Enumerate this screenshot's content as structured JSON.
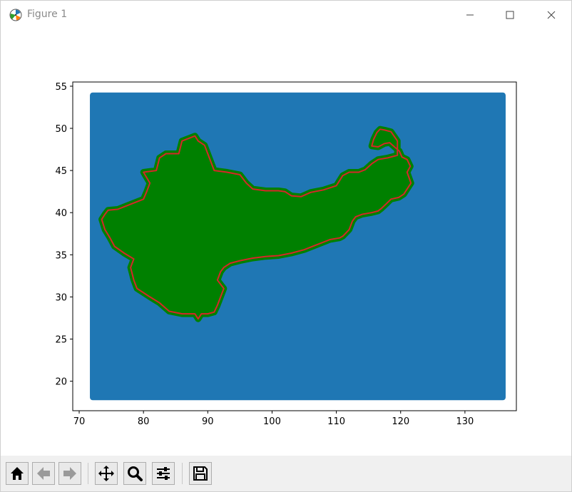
{
  "window": {
    "title": "Figure 1",
    "controls": [
      "minimize",
      "maximize",
      "close"
    ]
  },
  "toolbar": {
    "buttons": [
      {
        "name": "home-button",
        "icon": "home-icon"
      },
      {
        "name": "back-button",
        "icon": "arrow-left-icon"
      },
      {
        "name": "forward-button",
        "icon": "arrow-right-icon"
      },
      {
        "name": "pan-button",
        "icon": "move-icon"
      },
      {
        "name": "zoom-button",
        "icon": "magnifier-icon"
      },
      {
        "name": "configure-subplots-button",
        "icon": "sliders-icon"
      },
      {
        "name": "save-button",
        "icon": "floppy-disk-icon"
      }
    ]
  },
  "colors": {
    "background_points": "#1f77b4",
    "region_fill": "#008000",
    "outline": "#d62728"
  },
  "chart_data": {
    "type": "scatter",
    "title": "",
    "xlabel": "",
    "ylabel": "",
    "xlim": [
      69,
      138
    ],
    "ylim": [
      16.5,
      55.5
    ],
    "xticks": [
      70,
      80,
      90,
      100,
      110,
      120,
      130
    ],
    "yticks": [
      20,
      25,
      30,
      35,
      40,
      45,
      50,
      55
    ],
    "grid": false,
    "series": [
      {
        "kind": "grid-points",
        "color": "#1f77b4",
        "x_range": [
          72,
          136
        ],
        "y_range": [
          18,
          54
        ]
      },
      {
        "kind": "filled-region",
        "color": "#008000",
        "outline_color": "#d62728",
        "polygon": [
          [
            74.5,
            40.3
          ],
          [
            76,
            40.4
          ],
          [
            78,
            41.0
          ],
          [
            80,
            41.6
          ],
          [
            80.5,
            42.5
          ],
          [
            81,
            43.5
          ],
          [
            80,
            44.8
          ],
          [
            82,
            45.0
          ],
          [
            82.5,
            46.5
          ],
          [
            83.5,
            47.0
          ],
          [
            85.5,
            47.0
          ],
          [
            86,
            48.5
          ],
          [
            87,
            48.8
          ],
          [
            88,
            49.1
          ],
          [
            88.5,
            48.5
          ],
          [
            89.5,
            48.0
          ],
          [
            90,
            47.0
          ],
          [
            90.5,
            46.0
          ],
          [
            91,
            45.0
          ],
          [
            93,
            44.8
          ],
          [
            95,
            44.5
          ],
          [
            96,
            43.5
          ],
          [
            97,
            42.8
          ],
          [
            99,
            42.6
          ],
          [
            101,
            42.6
          ],
          [
            102,
            42.5
          ],
          [
            103,
            42.0
          ],
          [
            104.5,
            41.9
          ],
          [
            106,
            42.4
          ],
          [
            108,
            42.7
          ],
          [
            110,
            43.2
          ],
          [
            111,
            44.4
          ],
          [
            112,
            44.8
          ],
          [
            113.5,
            44.8
          ],
          [
            114.5,
            45.1
          ],
          [
            115.5,
            45.8
          ],
          [
            116.5,
            46.3
          ],
          [
            118,
            46.5
          ],
          [
            119.5,
            46.8
          ],
          [
            119.5,
            48.5
          ],
          [
            118.5,
            49.6
          ],
          [
            117.5,
            49.8
          ],
          [
            116.8,
            49.9
          ],
          [
            116.3,
            49.5
          ],
          [
            115.8,
            48.7
          ],
          [
            115.5,
            47.9
          ],
          [
            116.5,
            47.8
          ],
          [
            117.5,
            48.2
          ],
          [
            118.3,
            48.3
          ],
          [
            119.2,
            47.7
          ],
          [
            119.8,
            47.3
          ],
          [
            120.2,
            46.6
          ],
          [
            121.0,
            46.3
          ],
          [
            121.5,
            45.5
          ],
          [
            121.0,
            44.8
          ],
          [
            121.6,
            43.5
          ],
          [
            120.5,
            42.2
          ],
          [
            119.7,
            41.8
          ],
          [
            118.5,
            41.6
          ],
          [
            117.7,
            41.0
          ],
          [
            117,
            40.5
          ],
          [
            116.5,
            40.2
          ],
          [
            115.5,
            40.0
          ],
          [
            114,
            39.8
          ],
          [
            113,
            39.5
          ],
          [
            112.5,
            39.0
          ],
          [
            112,
            38.0
          ],
          [
            111,
            37.2
          ],
          [
            110.5,
            37.0
          ],
          [
            109,
            36.8
          ],
          [
            107,
            36.2
          ],
          [
            105,
            35.6
          ],
          [
            103,
            35.2
          ],
          [
            101,
            34.9
          ],
          [
            99,
            34.8
          ],
          [
            97,
            34.6
          ],
          [
            95,
            34.3
          ],
          [
            93.5,
            34.0
          ],
          [
            92.5,
            33.5
          ],
          [
            92.0,
            33.0
          ],
          [
            91.5,
            32.0
          ],
          [
            92.5,
            31.0
          ],
          [
            92.0,
            30.0
          ],
          [
            91.5,
            29.0
          ],
          [
            91.0,
            28.2
          ],
          [
            90,
            28.0
          ],
          [
            89,
            28.0
          ],
          [
            88.5,
            27.4
          ],
          [
            88,
            28.0
          ],
          [
            86,
            28.0
          ],
          [
            84,
            28.3
          ],
          [
            82.5,
            29.3
          ],
          [
            81.0,
            30.0
          ],
          [
            80.0,
            30.5
          ],
          [
            79.0,
            31.0
          ],
          [
            78.5,
            32.0
          ],
          [
            78.0,
            33.5
          ],
          [
            78.5,
            34.5
          ],
          [
            77.0,
            35.2
          ],
          [
            75.5,
            36.0
          ],
          [
            74.8,
            37.0
          ],
          [
            74.0,
            38.0
          ],
          [
            73.5,
            39.2
          ],
          [
            74.0,
            39.8
          ]
        ]
      }
    ]
  }
}
